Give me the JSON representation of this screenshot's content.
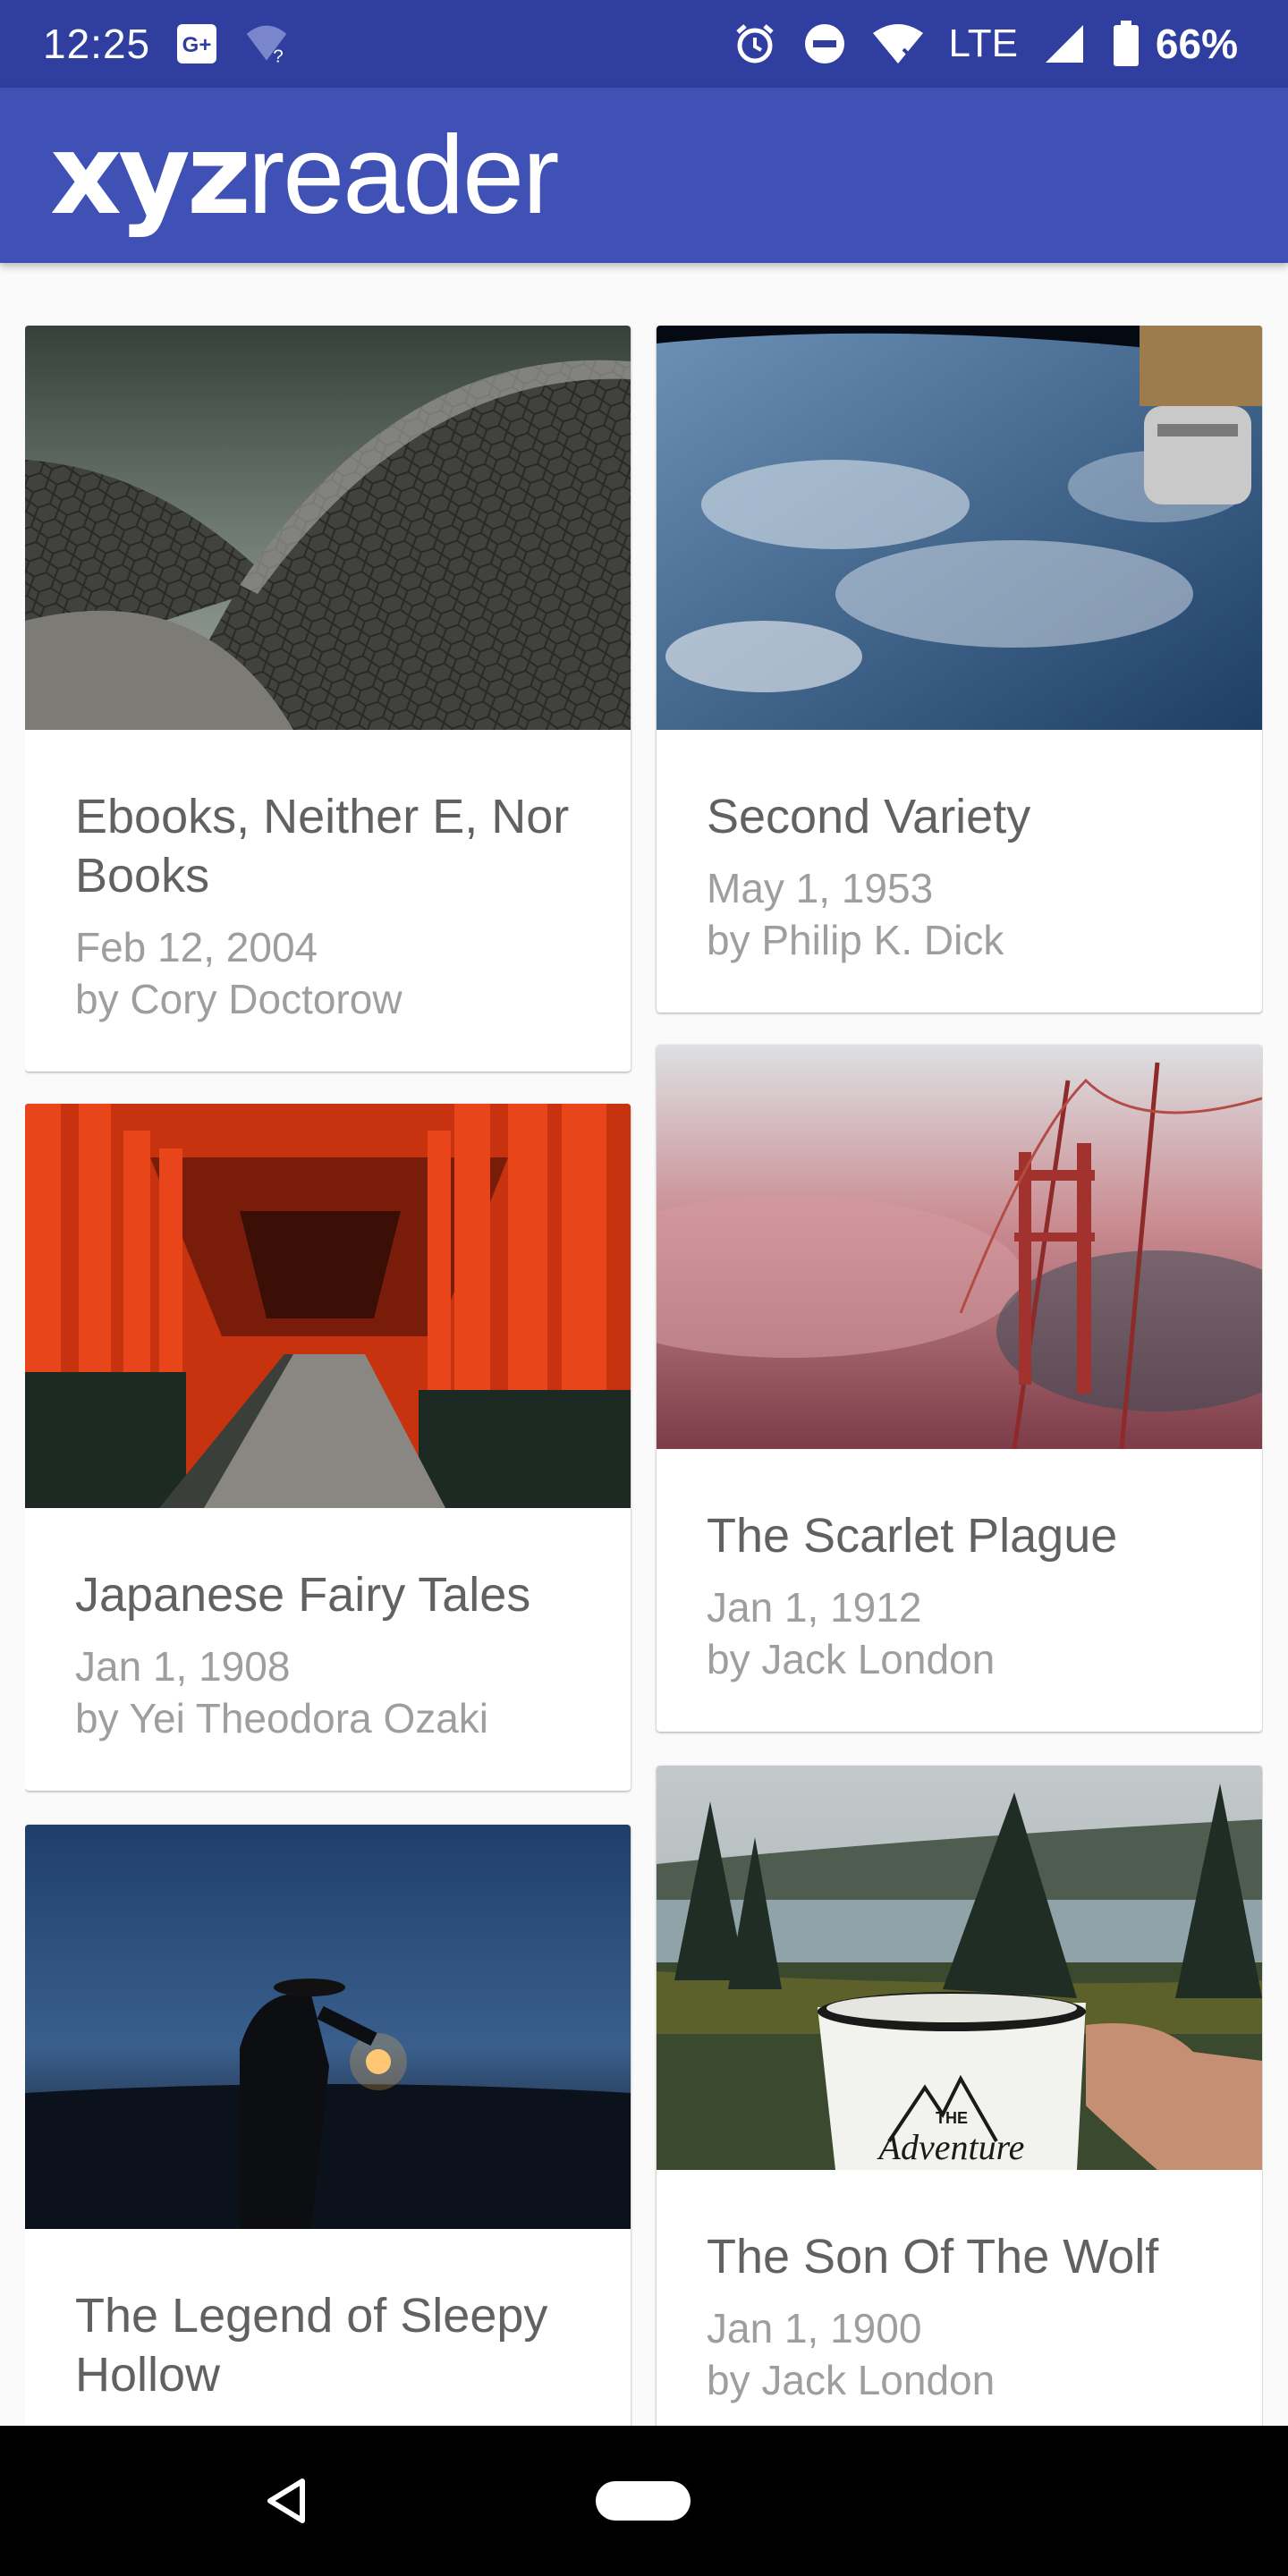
{
  "status_bar": {
    "time": "12:25",
    "network": "LTE",
    "battery": "66%",
    "icons": [
      "google-plus-icon",
      "wifi-question-icon",
      "alarm-icon",
      "do-not-disturb-icon",
      "wifi-icon",
      "signal-icon",
      "battery-icon"
    ]
  },
  "app_bar": {
    "logo_bold": "xyz",
    "logo_light": "reader",
    "color": "#3f51b5",
    "status_color": "#303f9f"
  },
  "articles": [
    {
      "title": "Ebooks, Neither E, Nor Books",
      "date": "Feb 12, 2004",
      "author": "by Cory Doctorow"
    },
    {
      "title": "Second Variety",
      "date": "May 1, 1953",
      "author": "by Philip K. Dick"
    },
    {
      "title": "Japanese Fairy Tales",
      "date": "Jan 1, 1908",
      "author": "by Yei Theodora Ozaki"
    },
    {
      "title": "The Scarlet Plague",
      "date": "Jan 1, 1912",
      "author": "by Jack London"
    },
    {
      "title": "The Legend of Sleepy Hollow",
      "date": "",
      "author": ""
    },
    {
      "title": "The Son Of The Wolf",
      "date": "Jan 1, 1900",
      "author": "by Jack London"
    }
  ],
  "image_text": {
    "mug_small": "THE",
    "mug_script": "Adventure"
  },
  "nav_bar": {
    "icons": [
      "back-icon",
      "home-pill-icon"
    ]
  }
}
